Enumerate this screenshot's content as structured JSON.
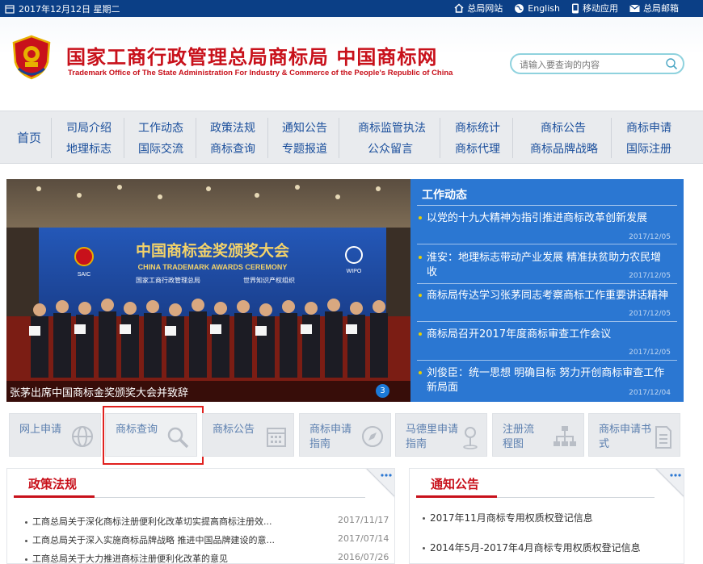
{
  "topbar": {
    "date": "2017年12月12日 星期二",
    "links": [
      {
        "label": "总局网站",
        "icon": "home-icon"
      },
      {
        "label": "English",
        "icon": "globe-icon"
      },
      {
        "label": "移动应用",
        "icon": "mobile-icon"
      },
      {
        "label": "总局邮箱",
        "icon": "mail-icon"
      }
    ]
  },
  "header": {
    "title_cn": "国家工商行政管理总局商标局 中国商标网",
    "title_en": "Trademark Office of The State Administration For Industry & Commerce of the People's Republic of China",
    "search_placeholder": "请输入要查询的内容"
  },
  "nav": {
    "home": "首页",
    "columns": [
      [
        "司局介绍",
        "地理标志"
      ],
      [
        "工作动态",
        "国际交流"
      ],
      [
        "政策法规",
        "商标查询"
      ],
      [
        "通知公告",
        "专题报道"
      ],
      [
        "商标监管执法",
        "公众留言"
      ],
      [
        "商标统计",
        "商标代理"
      ],
      [
        "商标公告",
        "商标品牌战略"
      ],
      [
        "商标申请",
        "国际注册"
      ]
    ]
  },
  "banner": {
    "caption": "张茅出席中国商标金奖颁奖大会并致辞",
    "slide_number": "3",
    "stage_title_cn": "中国商标金奖颁奖大会",
    "stage_title_en": "CHINA TRADEMARK AWARDS CEREMONY",
    "org_left": "国家工商行政管理总局",
    "org_right": "世界知识产权组织",
    "logo_left": "SAIC",
    "logo_right": "WIPO"
  },
  "work_news": {
    "title": "工作动态",
    "items": [
      {
        "title": "以党的十九大精神为指引推进商标改革创新发展",
        "date": "2017/12/05"
      },
      {
        "title": "淮安：地理标志带动产业发展 精准扶贫助力农民增收",
        "date": "2017/12/05"
      },
      {
        "title": "商标局传达学习张茅同志考察商标工作重要讲话精神",
        "date": "2017/12/05"
      },
      {
        "title": "商标局召开2017年度商标审查工作会议",
        "date": "2017/12/05"
      },
      {
        "title": "刘俊臣：统一思想 明确目标 努力开创商标审查工作新局面",
        "date": "2017/12/04"
      }
    ]
  },
  "services": [
    {
      "label": "网上申请",
      "icon": "globe-icon"
    },
    {
      "label": "商标查询",
      "icon": "magnifier-icon"
    },
    {
      "label": "商标公告",
      "icon": "calendar-icon"
    },
    {
      "label": "商标申请指南",
      "icon": "compass-icon"
    },
    {
      "label": "马德里申请指南",
      "icon": "map-pin-icon"
    },
    {
      "label": "注册流程图",
      "icon": "flowchart-icon"
    },
    {
      "label": "商标申请书式",
      "icon": "document-icon"
    }
  ],
  "policy": {
    "title": "政策法规",
    "items": [
      {
        "title": "工商总局关于深化商标注册便利化改革切实提高商标注册效...",
        "date": "2017/11/17"
      },
      {
        "title": "工商总局关于深入实施商标品牌战略 推进中国品牌建设的意...",
        "date": "2017/07/14"
      },
      {
        "title": "工商总局关于大力推进商标注册便利化改革的意见",
        "date": "2016/07/26"
      }
    ]
  },
  "notice": {
    "title": "通知公告",
    "items": [
      {
        "title": "2017年11月商标专用权质权登记信息"
      },
      {
        "title": "2014年5月-2017年4月商标专用权质权登记信息"
      }
    ]
  },
  "colors": {
    "topbar": "#0b3f86",
    "brand_red": "#c8111b",
    "nav_text": "#1b4f9c",
    "news_panel": "#2b77d2",
    "highlight": "#e0201e"
  }
}
